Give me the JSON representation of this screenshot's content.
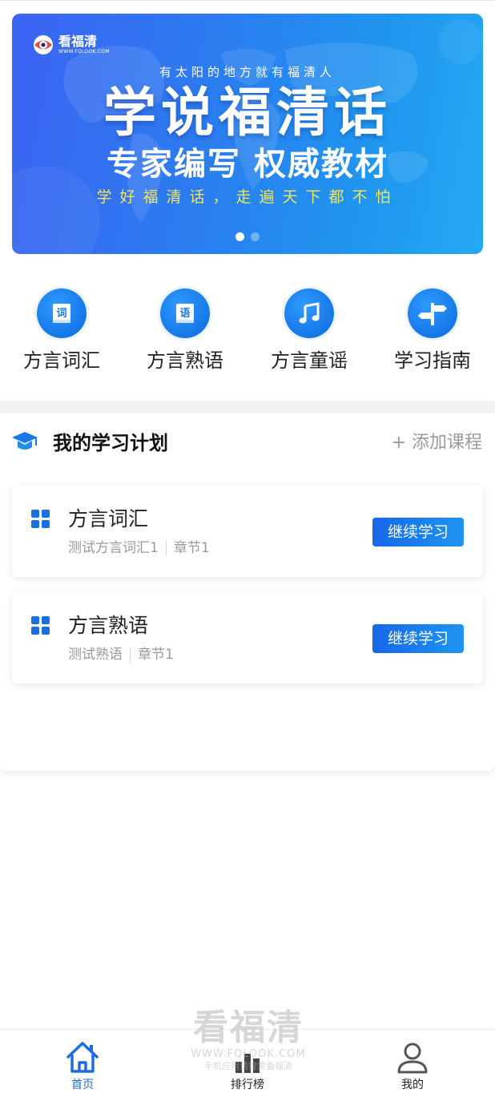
{
  "banner": {
    "logo_name": "看福清",
    "logo_url": "WWW.FQLOOK.COM",
    "tagline": "有太阳的地方就有福清人",
    "headline": "学说福清话",
    "subline": "专家编写 权威教材",
    "slogan": "学好福清话，走遍天下都不怕",
    "slide_count": 2,
    "active_slide": 1
  },
  "categories": [
    {
      "label": "方言词汇",
      "icon": "vocabulary-book-icon",
      "glyph": "词"
    },
    {
      "label": "方言熟语",
      "icon": "idiom-book-icon",
      "glyph": "语"
    },
    {
      "label": "方言童谣",
      "icon": "music-note-icon"
    },
    {
      "label": "学习指南",
      "icon": "signpost-icon"
    }
  ],
  "plan": {
    "title": "我的学习计划",
    "add_label": "+ 添加课程",
    "courses": [
      {
        "name": "方言词汇",
        "lesson": "测试方言词汇1",
        "chapter": "章节1",
        "button": "继续学习"
      },
      {
        "name": "方言熟语",
        "lesson": "测试熟语",
        "chapter": "章节1",
        "button": "继续学习"
      }
    ]
  },
  "watermark": {
    "name": "看福清",
    "url": "WWW.FQLOOK.COM",
    "note": "手机应用请搜索看福清"
  },
  "tabbar": {
    "items": [
      {
        "label": "首页",
        "icon": "home-icon",
        "active": true
      },
      {
        "label": "排行榜",
        "icon": "ranking-bars-icon",
        "active": false
      },
      {
        "label": "我的",
        "icon": "user-icon",
        "active": false
      }
    ]
  },
  "colors": {
    "accent": "#1a6fe0",
    "banner_start": "#3b63f2",
    "banner_end": "#25a9f3",
    "slogan": "#f3e45a"
  }
}
